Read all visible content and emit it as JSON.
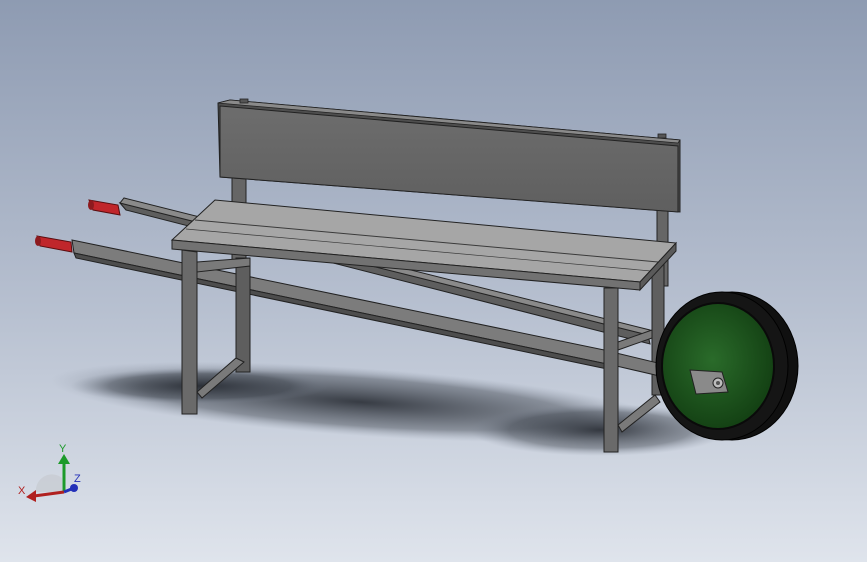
{
  "viewport": {
    "background_top": "#8e9bb2",
    "background_bottom": "#dfe4ec"
  },
  "model": {
    "parts": [
      "bench-backrest",
      "bench-seat",
      "bench-legs",
      "wheelbarrow-handles",
      "handle-grips",
      "wheel"
    ],
    "colors": {
      "body": "#6b6b6b",
      "seat_top": "#a5a5a5",
      "grip": "#c0262b",
      "wheel_hub": "#1d5a1d",
      "tire": "#111111"
    }
  },
  "triad": {
    "x_label": "X",
    "y_label": "Y",
    "z_label": "Z",
    "x_color": "#b0201f",
    "y_color": "#1c9a2a",
    "z_color": "#2330b8"
  }
}
